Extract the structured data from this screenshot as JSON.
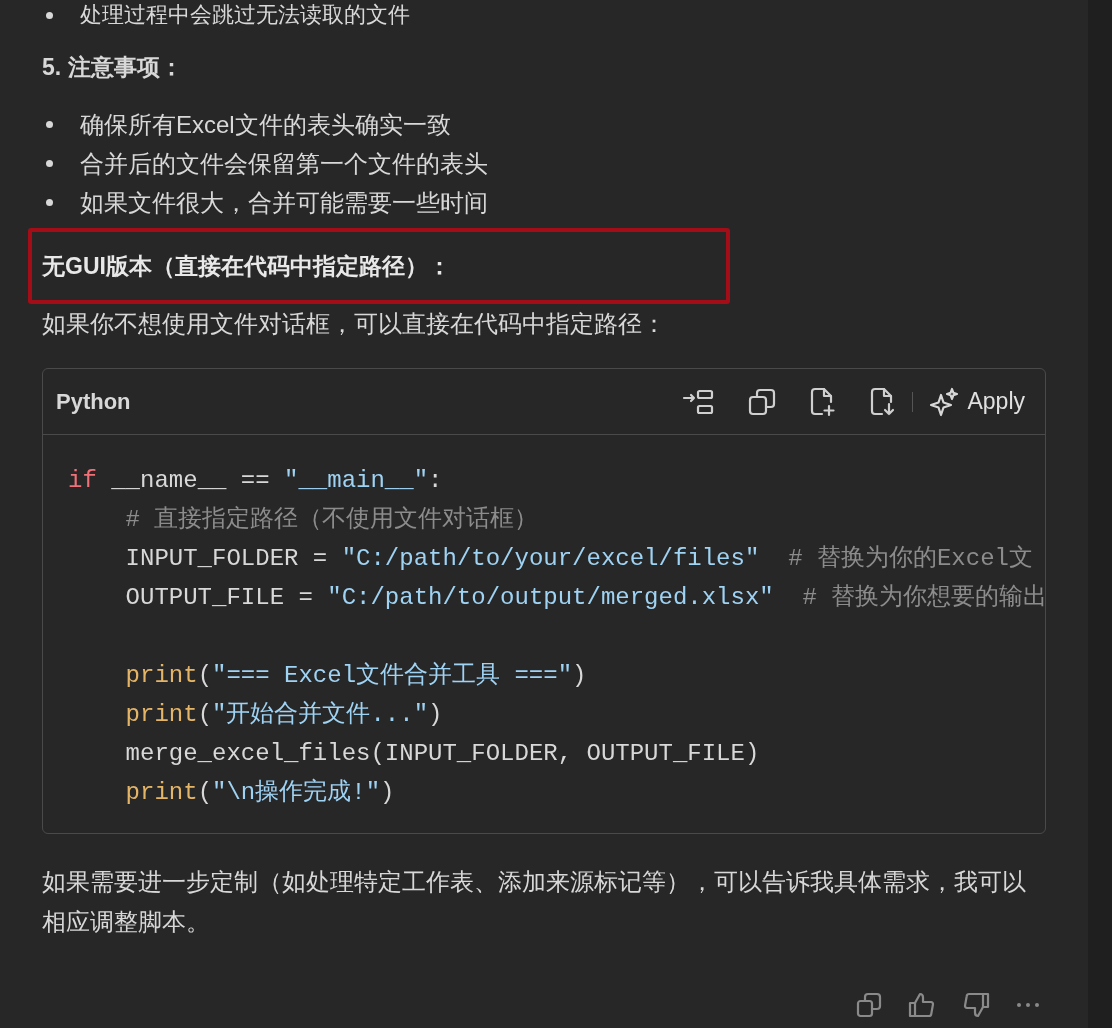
{
  "top_bullets": [
    "处理过程中会跳过无法读取的文件"
  ],
  "section": {
    "title": "5. 注意事项：",
    "bullets": [
      "确保所有Excel文件的表头确实一致",
      "合并后的文件会保留第一个文件的表头",
      "如果文件很大，合并可能需要一些时间"
    ]
  },
  "highlighted_heading": "无GUI版本（直接在代码中指定路径）：",
  "intro": "如果你不想使用文件对话框，可以直接在代码中指定路径：",
  "code_block": {
    "language": "Python",
    "apply_label": "Apply",
    "lines": [
      {
        "kind": "code",
        "indented": false,
        "tokens": [
          {
            "kind": "keyword",
            "text": "if"
          },
          {
            "kind": "plain",
            "text": " __name__ == "
          },
          {
            "kind": "string",
            "text": "\"__main__\""
          },
          {
            "kind": "plain",
            "text": ":"
          }
        ]
      },
      {
        "kind": "code",
        "indented": true,
        "tokens": [
          {
            "kind": "comment",
            "text": "# 直接指定路径（不使用文件对话框）"
          }
        ]
      },
      {
        "kind": "code",
        "indented": true,
        "tokens": [
          {
            "kind": "plain",
            "text": "INPUT_FOLDER = "
          },
          {
            "kind": "string",
            "text": "\"C:/path/to/your/excel/files\""
          },
          {
            "kind": "comment",
            "text": "  # 替换为你的Excel文"
          }
        ]
      },
      {
        "kind": "code",
        "indented": true,
        "tokens": [
          {
            "kind": "plain",
            "text": "OUTPUT_FILE = "
          },
          {
            "kind": "string",
            "text": "\"C:/path/to/output/merged.xlsx\""
          },
          {
            "kind": "comment",
            "text": "  # 替换为你想要的输出"
          }
        ]
      },
      {
        "kind": "blank"
      },
      {
        "kind": "code",
        "indented": true,
        "tokens": [
          {
            "kind": "func",
            "text": "print"
          },
          {
            "kind": "plain",
            "text": "("
          },
          {
            "kind": "string",
            "text": "\"=== Excel文件合并工具 ===\""
          },
          {
            "kind": "plain",
            "text": ")"
          }
        ]
      },
      {
        "kind": "code",
        "indented": true,
        "tokens": [
          {
            "kind": "func",
            "text": "print"
          },
          {
            "kind": "plain",
            "text": "("
          },
          {
            "kind": "string",
            "text": "\"开始合并文件...\""
          },
          {
            "kind": "plain",
            "text": ")"
          }
        ]
      },
      {
        "kind": "code",
        "indented": true,
        "tokens": [
          {
            "kind": "plain",
            "text": "merge_excel_files(INPUT_FOLDER, OUTPUT_FILE)"
          }
        ]
      },
      {
        "kind": "code",
        "indented": true,
        "tokens": [
          {
            "kind": "func",
            "text": "print"
          },
          {
            "kind": "plain",
            "text": "("
          },
          {
            "kind": "string",
            "text": "\"\\n操作完成!\""
          },
          {
            "kind": "plain",
            "text": ")"
          }
        ]
      }
    ]
  },
  "closing": "如果需要进一步定制（如处理特定工作表、添加来源标记等），可以告诉我具体需求，我可以相应调整脚本。"
}
